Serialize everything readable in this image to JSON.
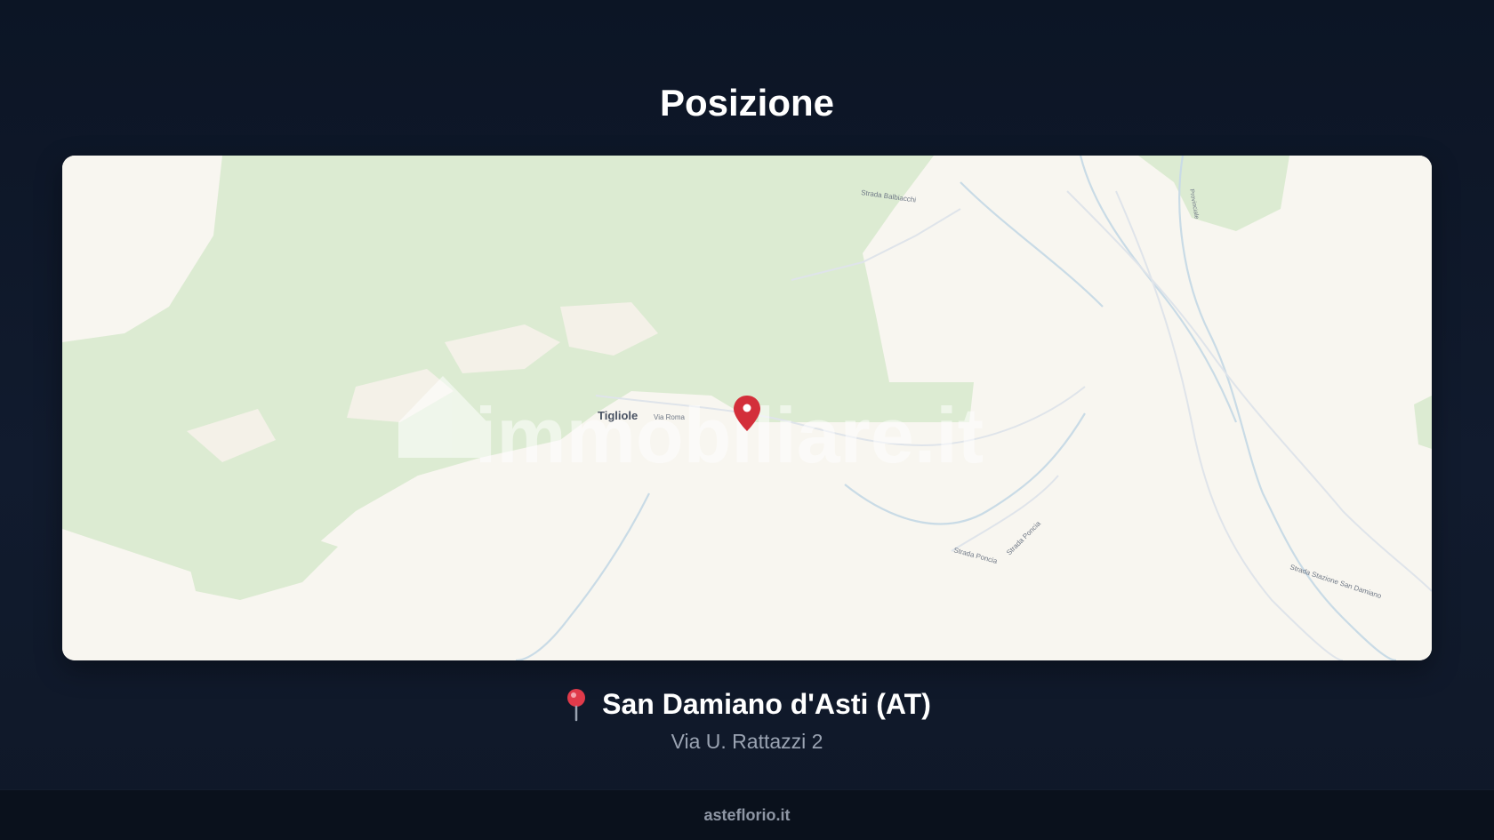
{
  "section": {
    "title": "Posizione"
  },
  "map": {
    "watermark": "immobiliare.it",
    "labels": {
      "town": "Tigliole",
      "road_1": "Strada Balbiacchi",
      "road_2": "Via Roma",
      "road_3": "Strada Poncia",
      "road_4": "Strada Poncia",
      "road_5": "Strada Stazione San Damiano",
      "road_6": "Provinciale"
    },
    "marker_icon": "map-marker-icon",
    "colors": {
      "land": "#f8f6f0",
      "forest": "#dcebd2",
      "water": "#c9dbe6",
      "marker": "#d32f3a"
    }
  },
  "location": {
    "pin_icon": "round-pushpin-icon",
    "city": "San Damiano d'Asti (AT)",
    "address": "Via U. Rattazzi 2"
  },
  "footer": {
    "link_text": "asteflorio.it"
  }
}
